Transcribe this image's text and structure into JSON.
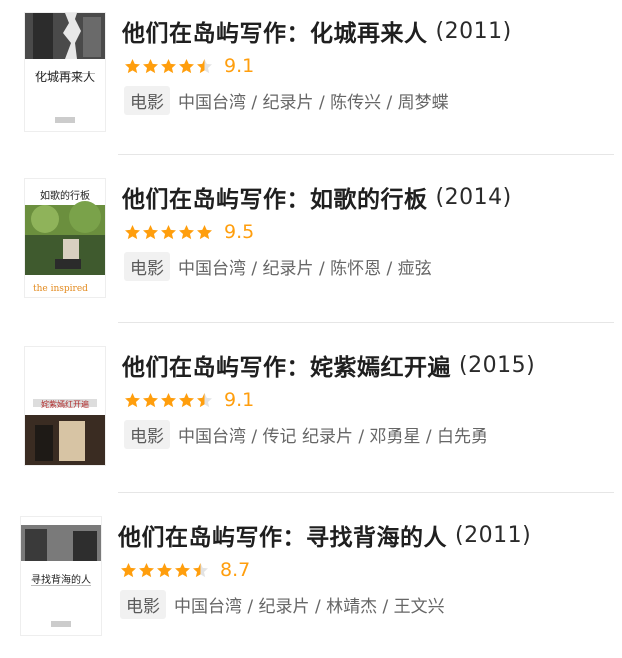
{
  "items": [
    {
      "title": "他们在岛屿写作：化城再来人",
      "year": "(2011)",
      "stars": 4.5,
      "score": "9.1",
      "tag": "电影",
      "meta": "中国台湾 / 纪录片 / 陈传兴 / 周梦蝶",
      "poster_title": "化城再来人"
    },
    {
      "title": "他们在岛屿写作：如歌的行板",
      "year": "(2014)",
      "stars": 5,
      "score": "9.5",
      "tag": "电影",
      "meta": "中国台湾 / 纪录片 / 陈怀恩 / 痖弦",
      "poster_title": "如歌的行板"
    },
    {
      "title": "他们在岛屿写作：姹紫嫣红开遍",
      "year": "(2015)",
      "stars": 4.5,
      "score": "9.1",
      "tag": "电影",
      "meta": "中国台湾 / 传记 纪录片 / 邓勇星 / 白先勇",
      "poster_title": "姹紫嫣红开遍"
    },
    {
      "title": "他们在岛屿写作：寻找背海的人",
      "year": "(2011)",
      "stars": 4.5,
      "score": "8.7",
      "tag": "电影",
      "meta": "中国台湾 / 纪录片 / 林靖杰 / 王文兴",
      "poster_title": "寻找背海的人"
    }
  ],
  "colors": {
    "star": "#ff9e0d",
    "star_empty": "#e3e3e3",
    "tag_bg": "#f1f1f1",
    "divider": "#e6e6e6"
  }
}
